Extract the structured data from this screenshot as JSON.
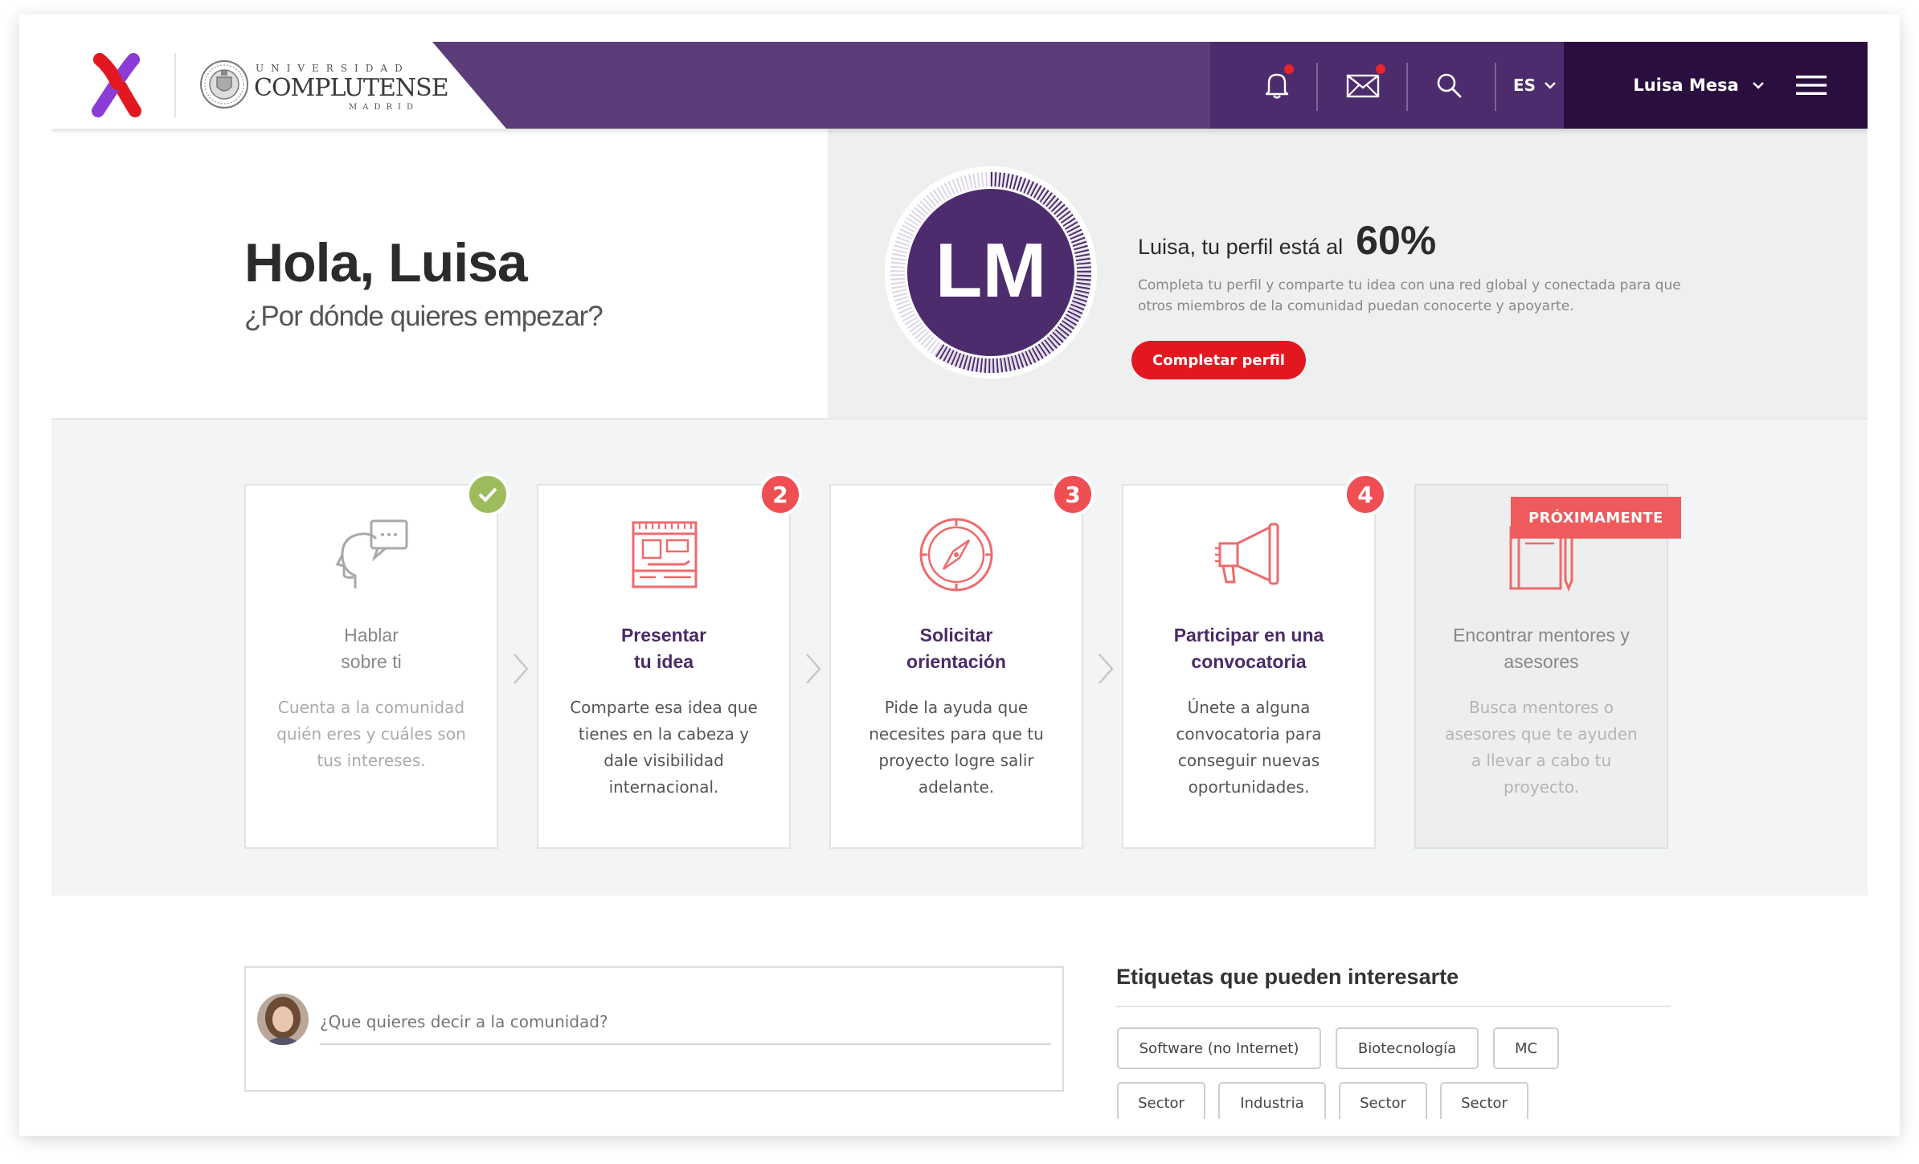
{
  "header": {
    "university": {
      "line1": "UNIVERSIDAD",
      "line2": "COMPLUTENSE",
      "line3": "MADRID"
    },
    "language": "ES",
    "user_name": "Luisa Mesa",
    "notifications_unread": true,
    "messages_unread": true
  },
  "hero": {
    "greeting": "Hola, Luisa",
    "subtitle": "¿Por dónde quieres empezar?",
    "avatar_initials": "LM",
    "profile_text": "Luisa, tu perfil está al",
    "profile_percent": "60%",
    "profile_progress": 0.6,
    "profile_desc": "Completa tu perfil y comparte tu idea con una red global y conectada para que otros miembros de la comunidad puedan conocerte y apoyarte.",
    "complete_button": "Completar perfil"
  },
  "steps": [
    {
      "title_1": "Hablar",
      "title_2": "sobre ti",
      "desc": "Cuenta a la comunidad quién eres y cuáles son tus intereses.",
      "status": "done",
      "badge": ""
    },
    {
      "title_1": "Presentar",
      "title_2": "tu idea",
      "desc": "Comparte esa idea que tienes en la cabeza y dale visibilidad internacional.",
      "status": "pending",
      "badge": "2"
    },
    {
      "title_1": "Solicitar",
      "title_2": "orientación",
      "desc": "Pide la ayuda que necesites para que tu proyecto logre salir adelante.",
      "status": "pending",
      "badge": "3"
    },
    {
      "title_1": "Participar en una",
      "title_2": "convocatoria",
      "desc": "Únete a alguna convocatoria para conseguir nuevas oportunidades.",
      "status": "pending",
      "badge": "4"
    },
    {
      "title_1": "Encontrar mentores y",
      "title_2": "asesores",
      "desc": "Busca mentores o asesores que te ayuden a llevar a cabo tu proyecto.",
      "status": "soon",
      "soon_label": "PRÓXIMAMENTE"
    }
  ],
  "post": {
    "placeholder": "¿Que quieres decir a la comunidad?"
  },
  "tags": {
    "title": "Etiquetas que pueden interesarte",
    "row1": [
      "Software (no Internet)",
      "Biotecnología",
      "MC"
    ],
    "row2": [
      "Sector",
      "Industria",
      "Sector",
      "Sector"
    ]
  },
  "colors": {
    "brand_purple": "#4d2c6e",
    "dark_purple": "#2a0e40",
    "accent_red": "#e3171f",
    "badge_red": "#ef4f52",
    "done_green": "#9dbd5c",
    "icon_coral": "#ee6a6c"
  }
}
